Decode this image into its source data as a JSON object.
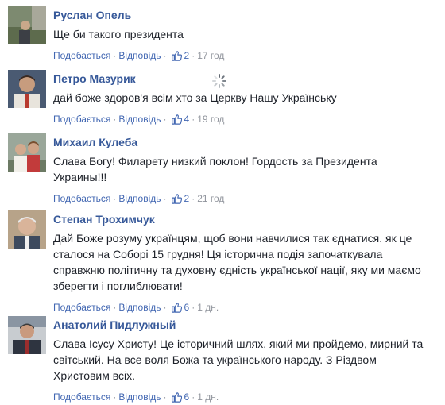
{
  "comments": [
    {
      "author": "Руслан Опель",
      "text": "Ще би такого президента",
      "like_label": "Подобається",
      "reply_label": "Відповідь",
      "likes": "2",
      "time": "17 год"
    },
    {
      "author": "Петро Мазурик",
      "text": "дай боже здоров'я всім хто за Церкву Нашу Українську",
      "like_label": "Подобається",
      "reply_label": "Відповідь",
      "likes": "4",
      "time": "19 год"
    },
    {
      "author": "Михаил Кулеба",
      "text": "Слава Богу! Филарету низкий поклон! Гордость за Президента Украины!!!",
      "like_label": "Подобається",
      "reply_label": "Відповідь",
      "likes": "2",
      "time": "21 год"
    },
    {
      "author": "Степан Трохимчук",
      "text": "Дай Боже розуму українцям, щоб вони навчилися так єднатися. як це сталося на Соборі 15 грудня! Ця історична подія започаткувала справжню політичну та духовну єдність української нації, яку ми маємо зберегти і поглиблювати!",
      "like_label": "Подобається",
      "reply_label": "Відповідь",
      "likes": "6",
      "time": "1 дн."
    },
    {
      "author": "Анатолий Пидлужный",
      "text": "Слава Ісусу Христу! Це історичний шлях, який ми пройдемо, мирний та світський. На все воля Божа та українського народу. З Різдвом Христовим всіх.",
      "like_label": "Подобається",
      "reply_label": "Відповідь",
      "likes": "6",
      "time": "1 дн."
    }
  ],
  "icons": {
    "like": "thumbs-up-icon",
    "loading": "loading-spinner-icon"
  },
  "colors": {
    "author": "#365899",
    "link": "#4267b2",
    "meta": "#90949c",
    "text": "#1d2129"
  }
}
